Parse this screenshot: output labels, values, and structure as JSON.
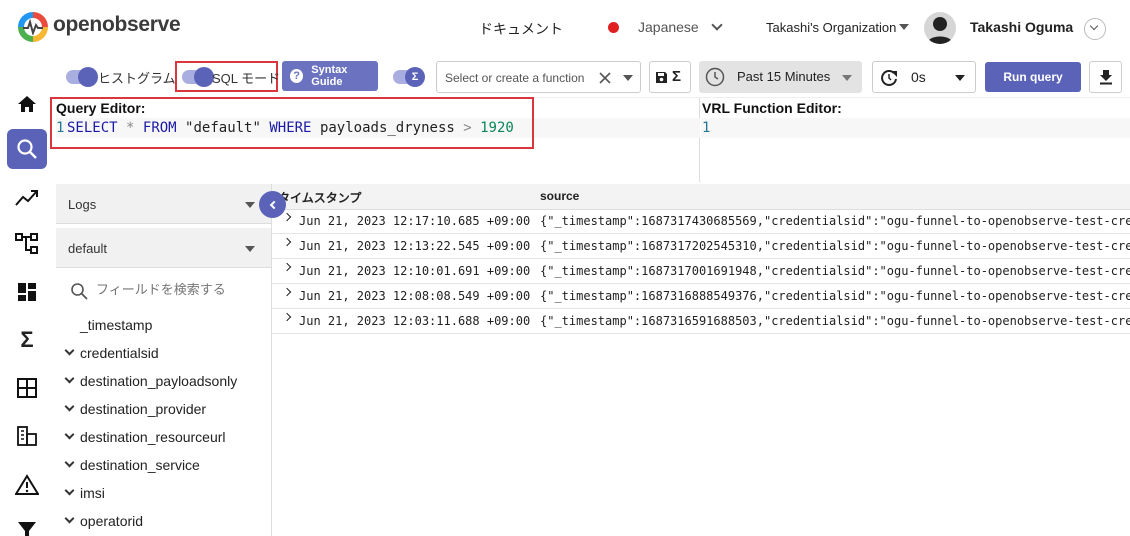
{
  "header": {
    "logo_text": "openobserve",
    "docs_label": "ドキュメント",
    "language": "Japanese",
    "organization": "Takashi's Organization",
    "user_name": "Takashi Oguma"
  },
  "toolbar": {
    "histogram_label": "ヒストグラム",
    "sql_mode_label": "SQL モード",
    "syntax_guide_label": "Syntax Guide",
    "function_placeholder": "Select or create a function",
    "date_range": "Past 15 Minutes",
    "refresh_interval": "0s",
    "run_query_label": "Run query"
  },
  "query_editor": {
    "title": "Query Editor:",
    "line_number": "1",
    "tokens": {
      "select": "SELECT",
      "star": "*",
      "from": "FROM",
      "table": "\"default\"",
      "where": "WHERE",
      "field": "payloads_dryness",
      "op": ">",
      "value": "1920"
    }
  },
  "vrl_editor": {
    "title": "VRL Function Editor:",
    "line_number": "1"
  },
  "field_panel": {
    "stream_type": "Logs",
    "stream_name": "default",
    "search_placeholder": "フィールドを検索する",
    "fields": [
      "_timestamp",
      "credentialsid",
      "destination_payloadsonly",
      "destination_provider",
      "destination_resourceurl",
      "destination_service",
      "imsi",
      "operatorid"
    ]
  },
  "table": {
    "headers": {
      "timestamp": "タイムスタンプ",
      "source": "source"
    },
    "rows": [
      {
        "timestamp": "Jun 21, 2023 12:17:10.685 +09:00",
        "source": "{\"_timestamp\":1687317430685569,\"credentialsid\":\"ogu-funnel-to-openobserve-test-cre"
      },
      {
        "timestamp": "Jun 21, 2023 12:13:22.545 +09:00",
        "source": "{\"_timestamp\":1687317202545310,\"credentialsid\":\"ogu-funnel-to-openobserve-test-cre"
      },
      {
        "timestamp": "Jun 21, 2023 12:10:01.691 +09:00",
        "source": "{\"_timestamp\":1687317001691948,\"credentialsid\":\"ogu-funnel-to-openobserve-test-cre"
      },
      {
        "timestamp": "Jun 21, 2023 12:08:08.549 +09:00",
        "source": "{\"_timestamp\":1687316888549376,\"credentialsid\":\"ogu-funnel-to-openobserve-test-cre"
      },
      {
        "timestamp": "Jun 21, 2023 12:03:11.688 +09:00",
        "source": "{\"_timestamp\":1687316591688503,\"credentialsid\":\"ogu-funnel-to-openobserve-test-cre"
      }
    ]
  },
  "icons": {
    "sigma": "Σ"
  },
  "colors": {
    "accent": "#5b63b8",
    "highlight_box": "#d9363e"
  }
}
